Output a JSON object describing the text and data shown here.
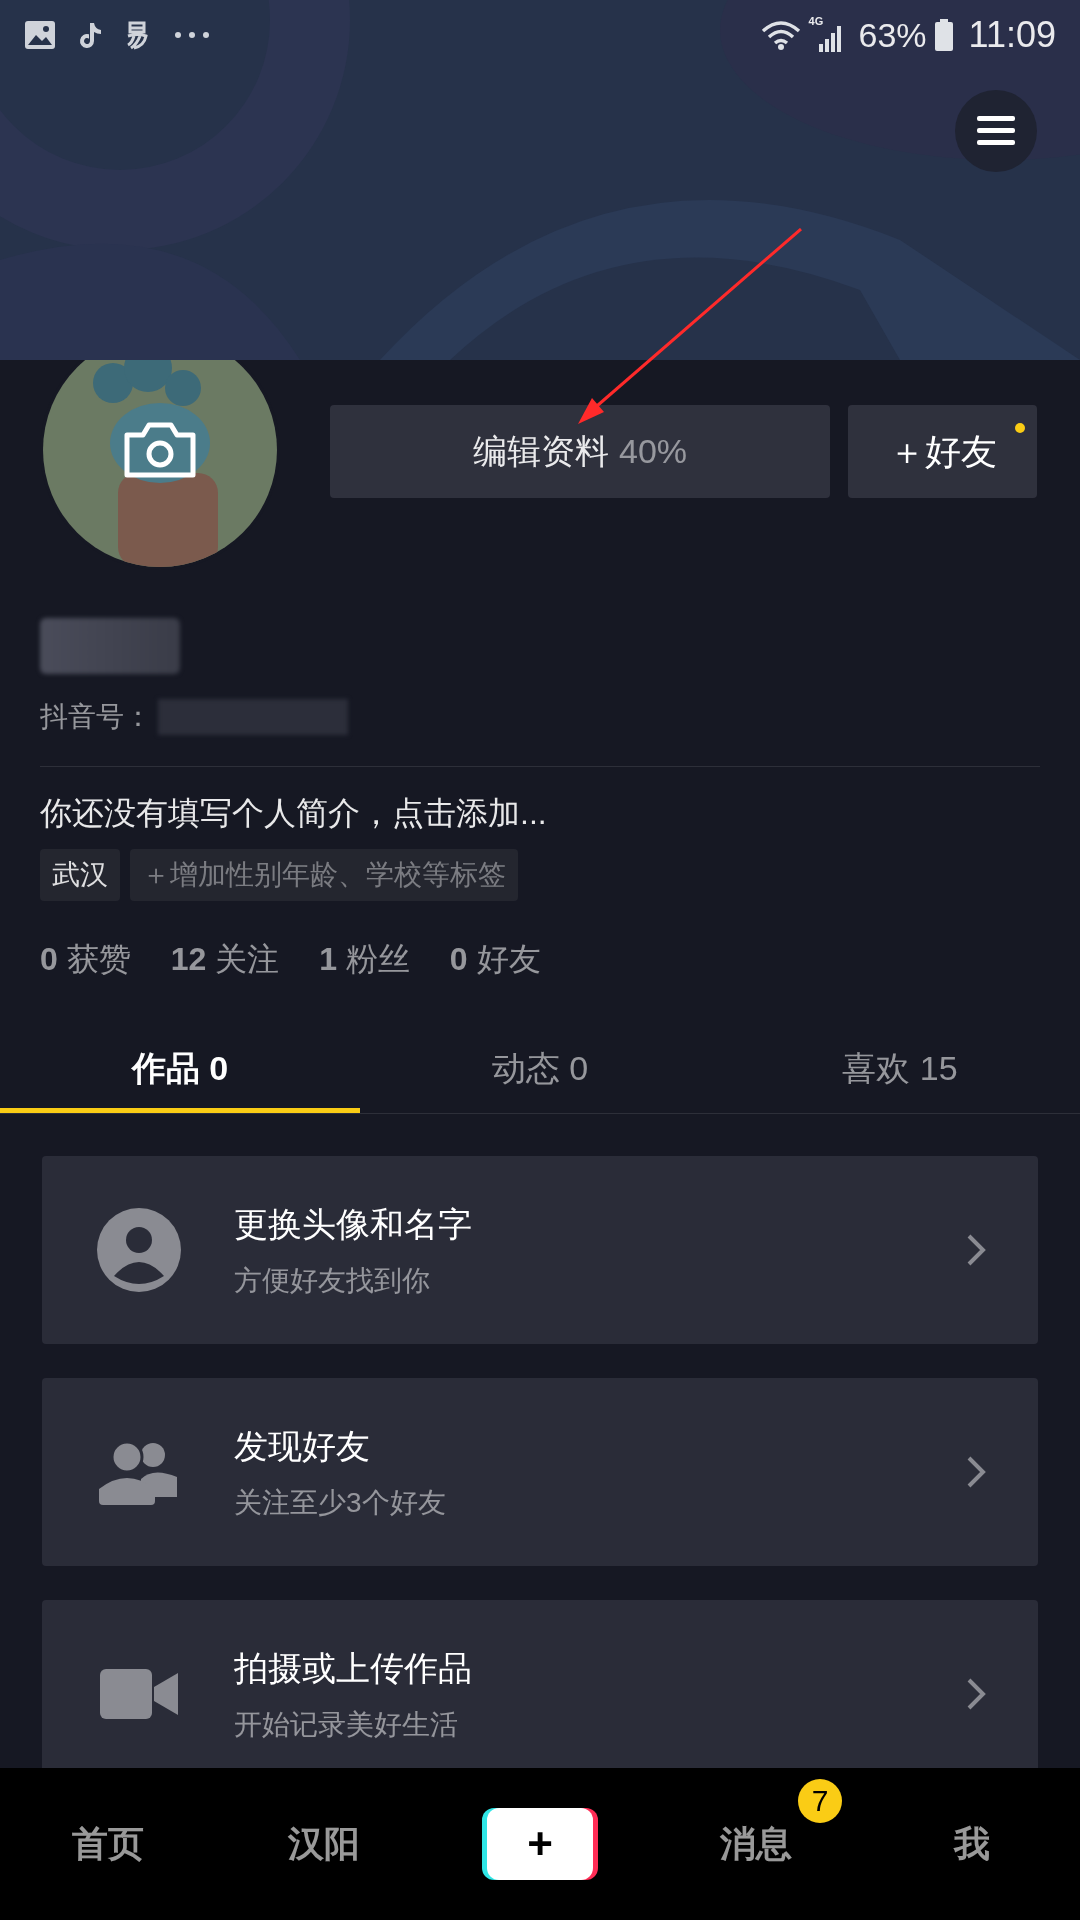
{
  "status_bar": {
    "network": "4G",
    "battery": "63%",
    "time": "11:09"
  },
  "profile": {
    "edit_button": {
      "label": "编辑资料",
      "progress": "40%"
    },
    "friend_button": {
      "label": "＋好友",
      "dot": true
    },
    "id_label": "抖音号：",
    "bio": "你还没有填写个人简介，点击添加...",
    "tags": [
      {
        "label": "武汉",
        "kind": "tag"
      },
      {
        "label": "＋增加性别年龄、学校等标签",
        "kind": "add"
      }
    ],
    "stats": [
      "**0** 获赞",
      "**12** 关注",
      "**1** 粉丝",
      "**0** 好友"
    ]
  },
  "tabs": [
    {
      "label": "作品 0",
      "selected": true
    },
    {
      "label": "动态 0",
      "selected": false
    },
    {
      "label": "喜欢 15",
      "selected": false
    }
  ],
  "cards": [
    {
      "title": "更换头像和名字",
      "subtitle": "方便好友找到你"
    },
    {
      "title": "发现好友",
      "subtitle": "关注至少3个好友"
    },
    {
      "title": "拍摄或上传作品",
      "subtitle": "开始记录美好生活"
    }
  ],
  "bottom_nav": [
    {
      "label": "首页",
      "kind": "tab"
    },
    {
      "label": "汉阳",
      "kind": "tab"
    },
    {
      "label": "+",
      "kind": "create"
    },
    {
      "label": "消息",
      "kind": "tab",
      "badge": "7"
    },
    {
      "label": "我",
      "kind": "tab"
    }
  ]
}
